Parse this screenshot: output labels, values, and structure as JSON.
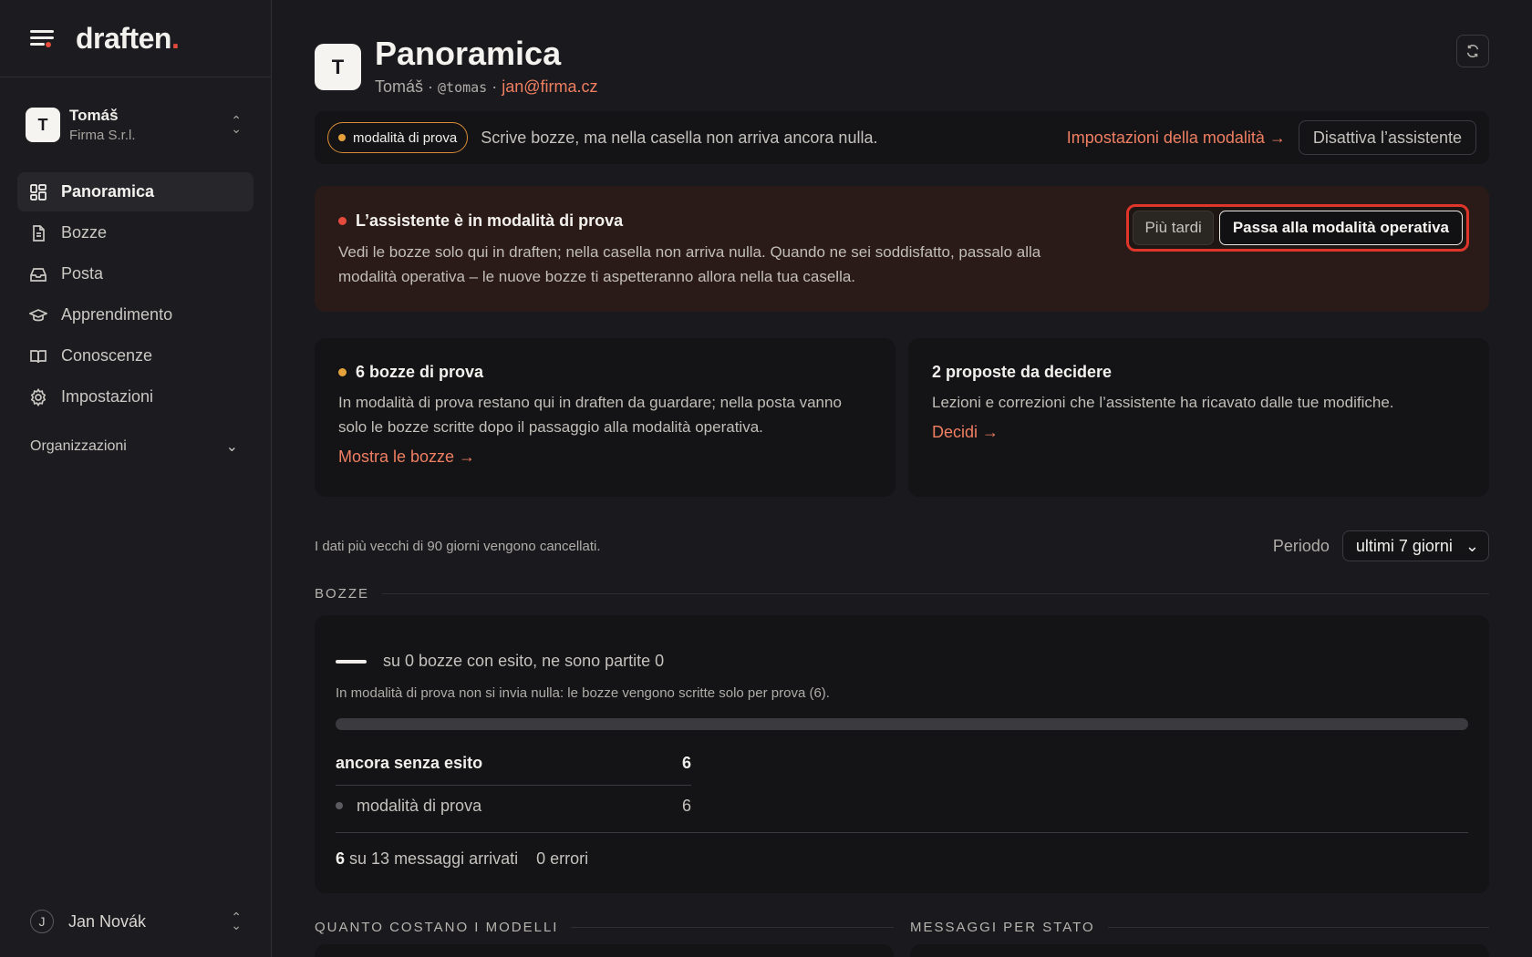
{
  "app": {
    "logo_text": "draften",
    "logo_dot": "."
  },
  "account": {
    "initial": "T",
    "name": "Tomáš",
    "org": "Firma S.r.l."
  },
  "nav": [
    {
      "label": "Panoramica",
      "icon": "dashboard-icon",
      "active": true
    },
    {
      "label": "Bozze",
      "icon": "document-icon"
    },
    {
      "label": "Posta",
      "icon": "inbox-icon"
    },
    {
      "label": "Apprendimento",
      "icon": "graduation-cap-icon"
    },
    {
      "label": "Conoscenze",
      "icon": "book-icon"
    },
    {
      "label": "Impostazioni",
      "icon": "gear-icon"
    }
  ],
  "org_section": {
    "label": "Organizzazioni"
  },
  "user": {
    "initial": "J",
    "name": "Jan Novák"
  },
  "header": {
    "initial": "T",
    "title": "Panoramica",
    "name": "Tomáš",
    "handle": "@tomas",
    "email": "jan@firma.cz"
  },
  "mode_bar": {
    "pill": "modalità di prova",
    "description": "Scrive bozze, ma nella casella non arriva ancora nulla.",
    "settings_link": "Impostazioni della modalità →",
    "disable_button": "Disattiva l’assistente"
  },
  "alert": {
    "title": "L’assistente è in modalità di prova",
    "text": "Vedi le bozze solo qui in draften; nella casella non arriva nulla. Quando ne sei soddisfatto, passalo alla modalità operativa – le nuove bozze ti aspetteranno allora nella tua casella.",
    "later_button": "Più tardi",
    "primary_button": "Passa alla modalità operativa"
  },
  "cards": [
    {
      "title": "6 bozze di prova",
      "text": "In modalità di prova restano qui in draften da guardare; nella posta vanno solo le bozze scritte dopo il passaggio alla modalità operativa.",
      "link": "Mostra le bozze →"
    },
    {
      "title": "2 proposte da decidere",
      "text": "Lezioni e correzioni che l’assistente ha ricavato dalle tue modifiche.",
      "link": "Decidi →"
    }
  ],
  "retention_note": "I dati più vecchi di 90 giorni vengono cancellati.",
  "period": {
    "label": "Periodo",
    "selected": "ultimi 7 giorni"
  },
  "drafts_section": {
    "heading": "BOZZE",
    "headline": "su 0 bozze con esito, ne sono partite 0",
    "note": "In modalità di prova non si invia nulla: le bozze vengono scritte solo per prova (6).",
    "progress_sent": 0,
    "pending_label": "ancora senza esito",
    "pending_value": "6",
    "trial_label": "modalità di prova",
    "trial_value": "6",
    "footer_count": "6",
    "footer_text": "su 13 messaggi arrivati",
    "footer_errors": "0 errori"
  },
  "bottom_sections": {
    "left": "QUANTO COSTANO I MODELLI",
    "right": "MESSAGGI PER STATO"
  },
  "colors": {
    "accent": "#f07f62",
    "danger": "#e54b3c",
    "warning": "#e5a23b"
  }
}
